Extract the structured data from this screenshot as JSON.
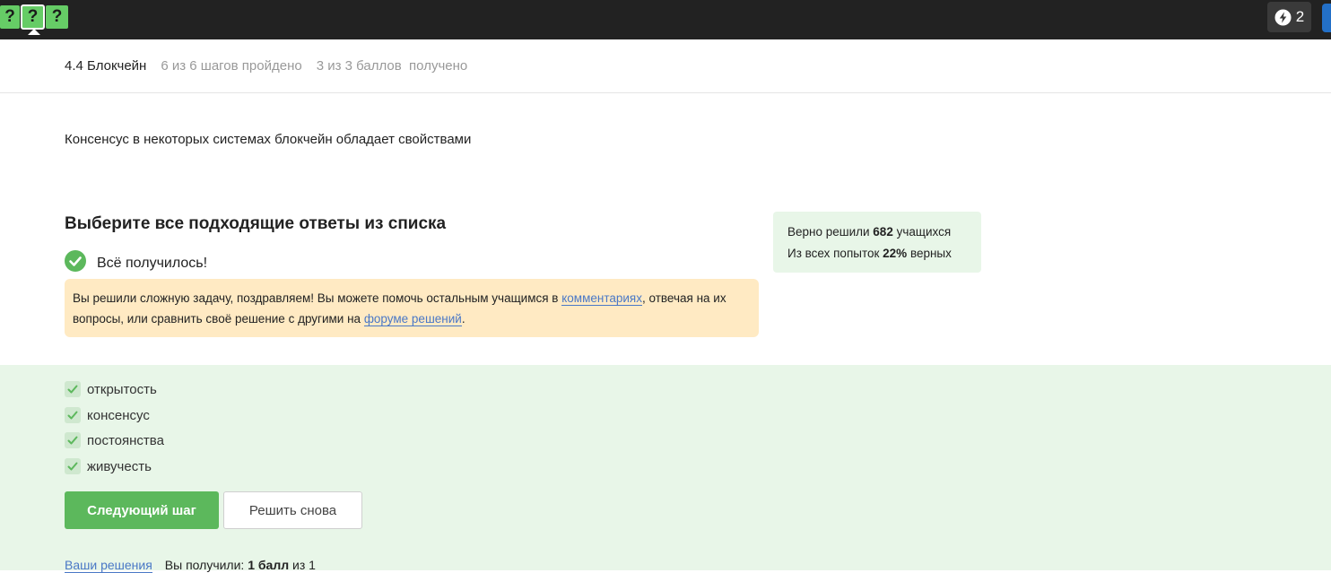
{
  "topbar": {
    "steps": [
      {
        "label": "?",
        "active": false
      },
      {
        "label": "?",
        "active": true
      },
      {
        "label": "?",
        "active": false
      }
    ],
    "notifications_count": "2",
    "accent_color": "#66cc66"
  },
  "lesson": {
    "title": "4.4 Блокчейн",
    "steps_progress": "6 из 6 шагов пройдено",
    "points_progress": "3 из 3 баллов  получено"
  },
  "question": {
    "text": "Консенсус в некоторых системах блокчейн обладает свойствами"
  },
  "task": {
    "heading": "Выберите все подходящие ответы из списка",
    "result_text": "Всё получилось!",
    "hint": {
      "part1": "Вы решили сложную задачу, поздравляем! Вы можете помочь остальным учащимся в ",
      "link1": "комментариях",
      "part2": ", отвечая на их вопросы, или сравнить своё решение с другими на ",
      "link2": "форуме решений",
      "part3": "."
    }
  },
  "stats": {
    "solved_prefix": "Верно решили ",
    "solved_count": "682",
    "solved_suffix": " учащихся",
    "attempts_prefix": "Из всех попыток ",
    "attempts_percent": "22%",
    "attempts_suffix": " верных"
  },
  "options": [
    {
      "label": "открытость",
      "checked": true
    },
    {
      "label": "консенсус",
      "checked": true
    },
    {
      "label": "постоянства",
      "checked": true
    },
    {
      "label": "живучесть",
      "checked": true
    }
  ],
  "buttons": {
    "next": "Следующий шаг",
    "retry": "Решить снова"
  },
  "footer": {
    "solutions_link": "Ваши решения",
    "score_prefix": "Вы получили: ",
    "score_value": "1 балл",
    "score_suffix": " из 1"
  }
}
